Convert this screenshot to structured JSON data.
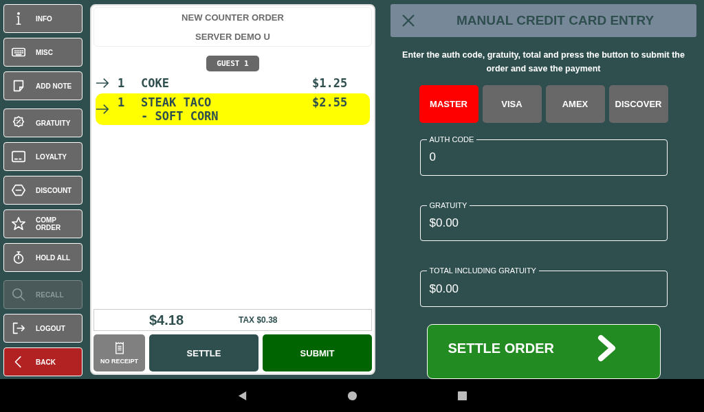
{
  "sidebar": {
    "items": [
      {
        "label": "INFO",
        "disabled": false,
        "kind": "normal"
      },
      {
        "label": "MISC",
        "disabled": false,
        "kind": "normal"
      },
      {
        "label": "ADD NOTE",
        "disabled": false,
        "kind": "normal"
      },
      {
        "label": "GRATUITY",
        "disabled": false,
        "kind": "normal"
      },
      {
        "label": "LOYALTY",
        "disabled": false,
        "kind": "normal"
      },
      {
        "label": "DISCOUNT",
        "disabled": false,
        "kind": "normal"
      },
      {
        "label": "COMP ORDER",
        "disabled": false,
        "kind": "normal"
      },
      {
        "label": "HOLD ALL",
        "disabled": false,
        "kind": "normal"
      },
      {
        "label": "RECALL",
        "disabled": true,
        "kind": "normal"
      },
      {
        "label": "LOGOUT",
        "disabled": false,
        "kind": "normal"
      },
      {
        "label": "BACK",
        "disabled": false,
        "kind": "danger"
      }
    ]
  },
  "order": {
    "title": "NEW COUNTER ORDER",
    "server": "SERVER DEMO U",
    "guest": "GUEST 1",
    "items": [
      {
        "qty": "1",
        "name": "COKE",
        "price": "$1.25",
        "selected": false
      },
      {
        "qty": "1",
        "name": "STEAK TACO",
        "modifier": "- SOFT CORN",
        "price": "$2.55",
        "selected": true
      }
    ],
    "total": "$4.18",
    "tax": "TAX $0.38",
    "buttons": [
      {
        "label": "NO RECEIPT",
        "kind": "receipt"
      },
      {
        "label": "SETTLE",
        "kind": "settle"
      },
      {
        "label": "SUBMIT",
        "kind": "submit"
      }
    ]
  },
  "payment": {
    "title": "MANUAL CREDIT CARD ENTRY",
    "instructions": "Enter the auth code, gratuity, total and press the button to submit the order and save the payment",
    "cards": [
      {
        "label": "MASTER",
        "selected": true
      },
      {
        "label": "VISA",
        "selected": false
      },
      {
        "label": "AMEX",
        "selected": false
      },
      {
        "label": "DISCOVER",
        "selected": false
      }
    ],
    "fields": [
      {
        "label": "AUTH CODE",
        "value": "0"
      },
      {
        "label": "GRATUITY",
        "value": "$0.00"
      },
      {
        "label": "TOTAL INCLUDING GRATUITY",
        "value": "$0.00"
      }
    ],
    "settle_button": "SETTLE ORDER"
  }
}
